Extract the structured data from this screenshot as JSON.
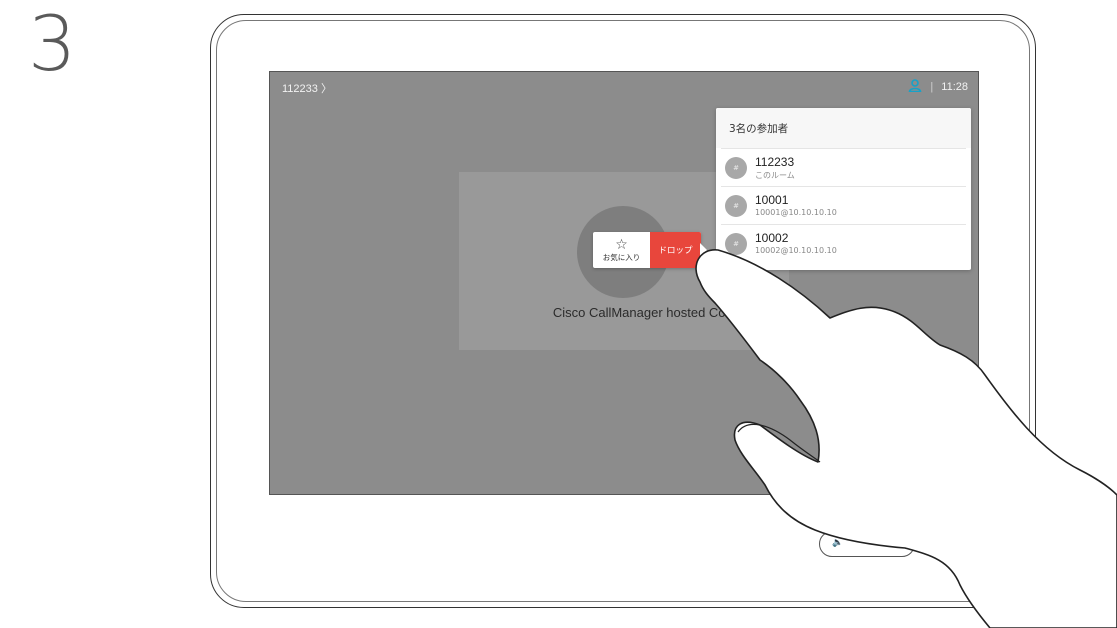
{
  "step": {
    "number": "3"
  },
  "topbar": {
    "title": "112233 〉",
    "person_icon": "person-icon",
    "separator": "|",
    "time": "11:28",
    "accent_color": "#16a2c9"
  },
  "call": {
    "name": "Cisco CallManager hosted Confere"
  },
  "action_popup": {
    "favorite_icon": "star-outline-icon",
    "favorite_label": "お気に入り",
    "drop_label": "ドロップ",
    "drop_color": "#e8463c"
  },
  "participants": {
    "header": "3名の参加者",
    "items": [
      {
        "avatar": "#",
        "name": "112233",
        "sub": "このルーム"
      },
      {
        "avatar": "#",
        "name": "10001",
        "sub": "10001@10.10.10.10"
      },
      {
        "avatar": "#",
        "name": "10002",
        "sub": "10002@10.10.10.10"
      }
    ]
  },
  "volume": {
    "icon": "speaker-icon"
  },
  "illustration": {
    "icon": "pointing-hand-icon"
  }
}
